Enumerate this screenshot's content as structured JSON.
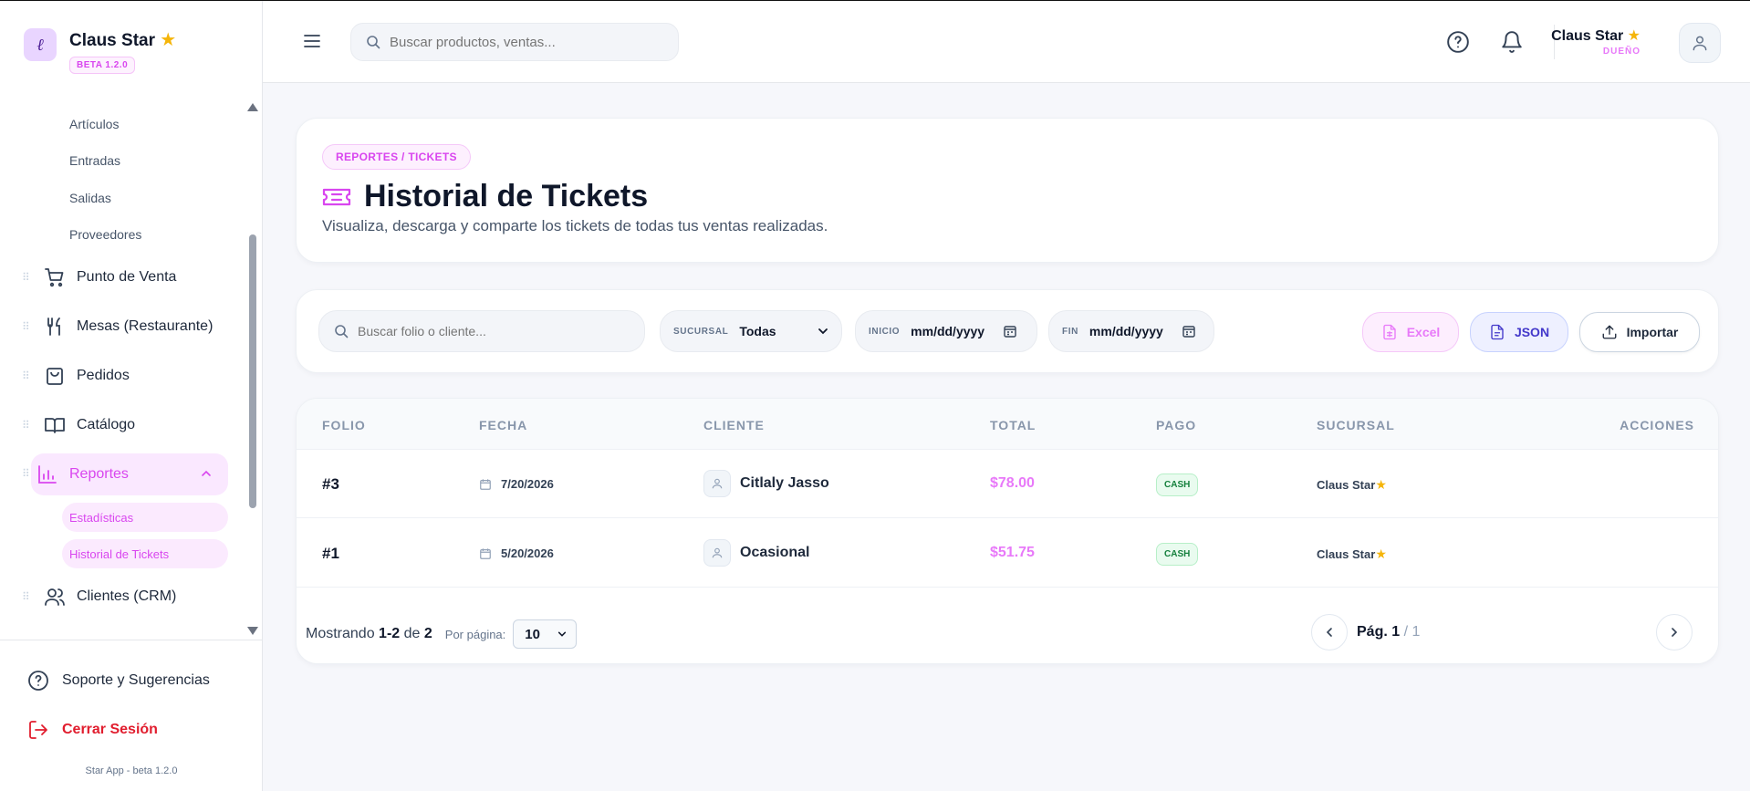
{
  "brand": {
    "name": "Claus Star",
    "badge": "BETA 1.2.0"
  },
  "sidebar": {
    "subitems_top": [
      "Artículos",
      "Entradas",
      "Salidas",
      "Proveedores"
    ],
    "items": [
      {
        "label": "Punto de Venta",
        "icon": "cart-icon"
      },
      {
        "label": "Mesas (Restaurante)",
        "icon": "utensils-icon"
      },
      {
        "label": "Pedidos",
        "icon": "bag-icon"
      },
      {
        "label": "Catálogo",
        "icon": "book-icon"
      },
      {
        "label": "Reportes",
        "icon": "chart-icon",
        "active": true
      },
      {
        "label": "Clientes (CRM)",
        "icon": "users-icon"
      }
    ],
    "reportes_sub": [
      "Estadísticas",
      "Historial de Tickets"
    ],
    "support": "Soporte y Sugerencias",
    "logout": "Cerrar Sesión",
    "version": "Star App - beta 1.2.0"
  },
  "topbar": {
    "search_placeholder": "Buscar productos, ventas...",
    "user_name": "Claus Star",
    "user_role": "DUEÑO"
  },
  "header": {
    "breadcrumb": "REPORTES / TICKETS",
    "title": "Historial de Tickets",
    "subtitle": "Visualiza, descarga y comparte los tickets de todas tus ventas realizadas."
  },
  "filters": {
    "search_placeholder": "Buscar folio o cliente...",
    "sucursal_label": "SUCURSAL",
    "sucursal_value": "Todas",
    "inicio_label": "INICIO",
    "inicio_value": "mm/dd/yyyy",
    "fin_label": "FIN",
    "fin_value": "mm/dd/yyyy",
    "excel": "Excel",
    "json": "JSON",
    "importar": "Importar"
  },
  "table": {
    "headers": [
      "FOLIO",
      "FECHA",
      "CLIENTE",
      "TOTAL",
      "PAGO",
      "SUCURSAL",
      "ACCIONES"
    ],
    "rows": [
      {
        "folio": "#3",
        "fecha": "7/20/2026",
        "cliente": "Citlaly Jasso",
        "total": "$78.00",
        "pago": "CASH",
        "sucursal": "Claus Star"
      },
      {
        "folio": "#1",
        "fecha": "5/20/2026",
        "cliente": "Ocasional",
        "total": "$51.75",
        "pago": "CASH",
        "sucursal": "Claus Star"
      }
    ],
    "showing_prefix": "Mostrando",
    "showing_range": "1-2",
    "showing_of": "de",
    "showing_total": "2",
    "per_page_label": "Por página:",
    "per_page_value": "10",
    "page_prefix": "Pág.",
    "page_current": "1",
    "page_total": "/ 1"
  },
  "colors": {
    "accent": "#d946ef",
    "danger": "#e11d2e",
    "star": "#f5b50a"
  }
}
